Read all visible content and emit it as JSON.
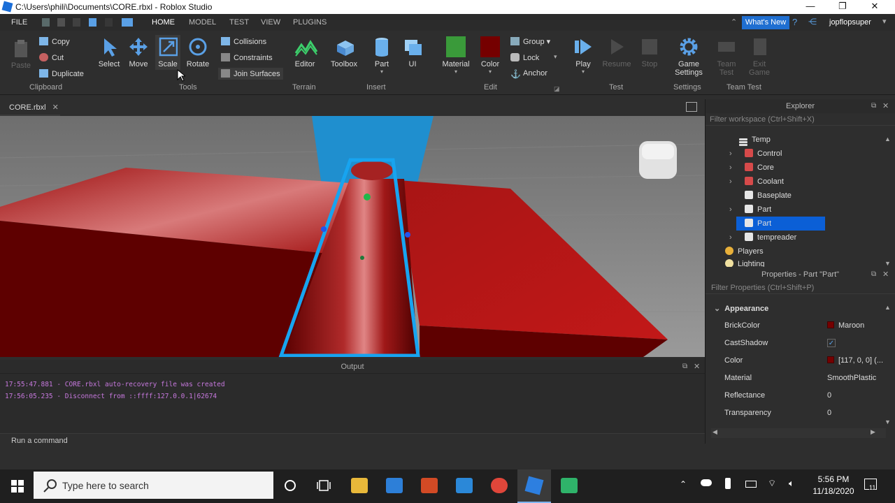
{
  "window": {
    "title": "C:\\Users\\phili\\Documents\\CORE.rbxl - Roblox Studio",
    "minimize": "—",
    "maximize": "❐",
    "close": "✕"
  },
  "menu": {
    "file": "FILE",
    "tabs": [
      "HOME",
      "MODEL",
      "TEST",
      "VIEW",
      "PLUGINS"
    ],
    "whats_new": "What's New",
    "user": "jopflopsuper"
  },
  "ribbon": {
    "clipboard": {
      "paste": "Paste",
      "copy": "Copy",
      "cut": "Cut",
      "duplicate": "Duplicate",
      "group": "Clipboard"
    },
    "tools": {
      "select": "Select",
      "move": "Move",
      "scale": "Scale",
      "rotate": "Rotate",
      "collisions": "Collisions",
      "constraints": "Constraints",
      "join_surfaces": "Join Surfaces",
      "group": "Tools"
    },
    "terrain": {
      "editor": "Editor",
      "group": "Terrain"
    },
    "insert": {
      "toolbox": "Toolbox",
      "part": "Part",
      "ui": "UI",
      "group": "Insert"
    },
    "edit": {
      "material": "Material",
      "color": "Color",
      "group_btn": "Group",
      "lock": "Lock",
      "anchor": "Anchor",
      "group": "Edit"
    },
    "test": {
      "play": "Play",
      "resume": "Resume",
      "stop": "Stop",
      "group": "Test"
    },
    "settings": {
      "game_settings_1": "Game",
      "game_settings_2": "Settings",
      "group": "Settings"
    },
    "team": {
      "team_test_1": "Team",
      "team_test_2": "Test",
      "exit_game_1": "Exit",
      "exit_game_2": "Game",
      "group": "Team Test"
    }
  },
  "doc_tab": {
    "label": "CORE.rbxl",
    "close": "✕"
  },
  "output": {
    "title": "Output",
    "lines": [
      "17:55:47.881 - CORE.rbxl auto-recovery file was created",
      "17:56:05.235 - Disconnect from ::ffff:127.0.0.1|62674"
    ],
    "command_placeholder": "Run a command"
  },
  "explorer": {
    "title": "Explorer",
    "filter": "Filter workspace (Ctrl+Shift+X)",
    "items": [
      {
        "label": "Temp"
      },
      {
        "label": "Control"
      },
      {
        "label": "Core"
      },
      {
        "label": "Coolant"
      },
      {
        "label": "Baseplate"
      },
      {
        "label": "Part"
      },
      {
        "label": "Part"
      },
      {
        "label": "tempreader"
      },
      {
        "label": "Players"
      },
      {
        "label": "Lighting"
      }
    ]
  },
  "properties": {
    "title": "Properties - Part \"Part\"",
    "filter": "Filter Properties (Ctrl+Shift+P)",
    "section": "Appearance",
    "rows": [
      {
        "key": "BrickColor",
        "value": "Maroon"
      },
      {
        "key": "CastShadow",
        "value": "✓"
      },
      {
        "key": "Color",
        "value": "[117, 0, 0] (..."
      },
      {
        "key": "Material",
        "value": "SmoothPlastic"
      },
      {
        "key": "Reflectance",
        "value": "0"
      },
      {
        "key": "Transparency",
        "value": "0"
      }
    ]
  },
  "taskbar": {
    "search_placeholder": "Type here to search",
    "time": "5:56 PM",
    "date": "11/18/2020",
    "notifications": "11"
  },
  "colors": {
    "accent": "#1f6fd1",
    "selection": "#0b5fd6",
    "part_red": "#8b0000"
  }
}
